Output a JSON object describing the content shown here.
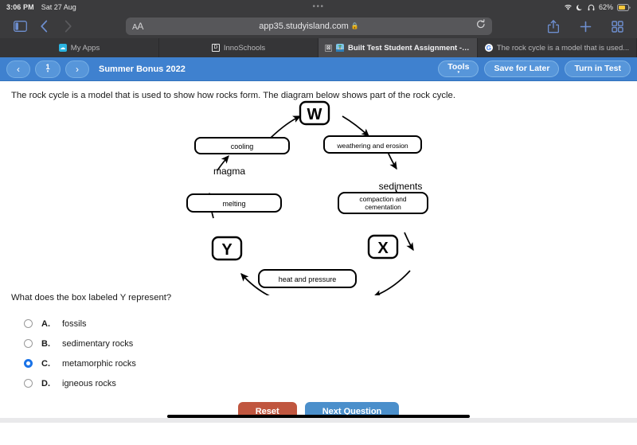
{
  "status_bar": {
    "time": "3:06 PM",
    "date": "Sat 27 Aug",
    "dots": "•••",
    "battery_percent": "62%",
    "icons": [
      "wifi-icon",
      "moon-icon",
      "headphones-icon",
      "battery-icon"
    ]
  },
  "browser": {
    "url": "app35.studyisland.com",
    "aa_label": "A",
    "aa_label_big": "A",
    "lock": "🔒",
    "icons": [
      "sidebar-icon",
      "back-icon",
      "forward-icon",
      "reload-icon",
      "share-icon",
      "new-tab-icon",
      "tabs-overview-icon"
    ],
    "tabs": [
      {
        "label": "My Apps",
        "favicon": "myapps-icon",
        "active": false
      },
      {
        "label": "InnoSchools",
        "favicon": "innoschools-icon",
        "favicon_letter": "D",
        "active": false
      },
      {
        "label": "Built Test Student Assignment - Stud...",
        "favicon": "studyisland-icon",
        "active": true,
        "close": "⊠"
      },
      {
        "label": "The rock cycle is a model that is used...",
        "favicon": "google-icon",
        "favicon_letter": "G",
        "active": false
      }
    ]
  },
  "appbar": {
    "prev_label": "‹",
    "next_label": "›",
    "page_number": "1",
    "page_caret": "▾",
    "title": "Summer Bonus 2022",
    "tools_label": "Tools",
    "tools_caret": "▾",
    "save_label": "Save for Later",
    "turnin_label": "Turn in Test",
    "accent_color": "#3f81cf"
  },
  "question": {
    "stem": "The rock cycle is a model that is used to show how rocks form. The diagram below shows part of the rock cycle.",
    "prompt": "What does the box labeled Y represent?",
    "choices": [
      {
        "letter": "A.",
        "text": "fossils",
        "selected": false
      },
      {
        "letter": "B.",
        "text": "sedimentary rocks",
        "selected": false
      },
      {
        "letter": "C.",
        "text": "metamorphic rocks",
        "selected": true
      },
      {
        "letter": "D.",
        "text": "igneous rocks",
        "selected": false
      }
    ],
    "selected_color": "#1a73e8"
  },
  "diagram": {
    "title": "rock cycle diagram",
    "nodes": [
      {
        "id": "W",
        "label": "W",
        "type": "letter-box"
      },
      {
        "id": "cooling",
        "label": "cooling",
        "type": "process-box"
      },
      {
        "id": "magma",
        "label": "magma",
        "type": "plain-text"
      },
      {
        "id": "weathering",
        "label": "weathering and erosion",
        "type": "process-box"
      },
      {
        "id": "sediments",
        "label": "sediments",
        "type": "plain-text"
      },
      {
        "id": "compaction",
        "label": "compaction and cementation",
        "type": "process-box"
      },
      {
        "id": "melting",
        "label": "melting",
        "type": "process-box"
      },
      {
        "id": "X",
        "label": "X",
        "type": "letter-box"
      },
      {
        "id": "Y",
        "label": "Y",
        "type": "letter-box"
      },
      {
        "id": "heat",
        "label": "heat and pressure",
        "type": "process-box"
      }
    ],
    "edges": [
      {
        "from": "cooling",
        "to": "W"
      },
      {
        "from": "W",
        "to": "weathering"
      },
      {
        "from": "weathering",
        "to": "sediments"
      },
      {
        "from": "sediments",
        "to": "compaction"
      },
      {
        "from": "compaction",
        "to": "X"
      },
      {
        "from": "X",
        "to": "heat"
      },
      {
        "from": "heat",
        "to": "Y"
      },
      {
        "from": "Y",
        "to": "melting"
      },
      {
        "from": "melting",
        "to": "magma"
      },
      {
        "from": "magma",
        "to": "cooling"
      }
    ]
  },
  "footer": {
    "reset_label": "Reset",
    "next_label": "Next Question",
    "reset_color": "#c0563f",
    "next_color": "#4b8fcb"
  }
}
